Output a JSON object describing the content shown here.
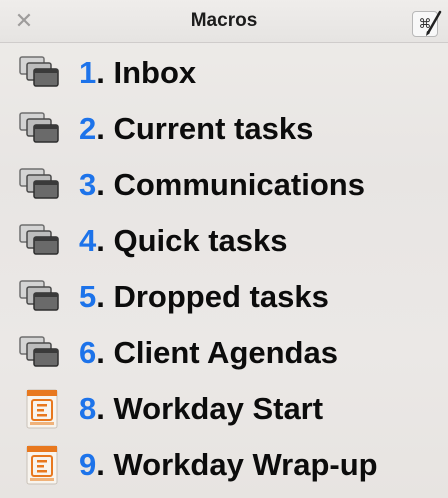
{
  "window": {
    "title": "Macros",
    "editor_glyph": "⌘"
  },
  "colors": {
    "number_accent": "#1d73ea",
    "label_text": "#0c0c0c",
    "fm_icon_orange": "#e8781e"
  },
  "macros": [
    {
      "number": "1",
      "label": ". Inbox",
      "icon": "window-stack-icon"
    },
    {
      "number": "2",
      "label": ". Current tasks",
      "icon": "window-stack-icon"
    },
    {
      "number": "3",
      "label": ". Communications",
      "icon": "window-stack-icon"
    },
    {
      "number": "4",
      "label": ". Quick tasks",
      "icon": "window-stack-icon"
    },
    {
      "number": "5",
      "label": ". Dropped tasks",
      "icon": "window-stack-icon"
    },
    {
      "number": "6",
      "label": ". Client Agendas",
      "icon": "window-stack-icon"
    },
    {
      "number": "8",
      "label": ". Workday Start",
      "icon": "keyboard-maestro-file-icon"
    },
    {
      "number": "9",
      "label": ". Workday Wrap-up",
      "icon": "keyboard-maestro-file-icon"
    }
  ]
}
